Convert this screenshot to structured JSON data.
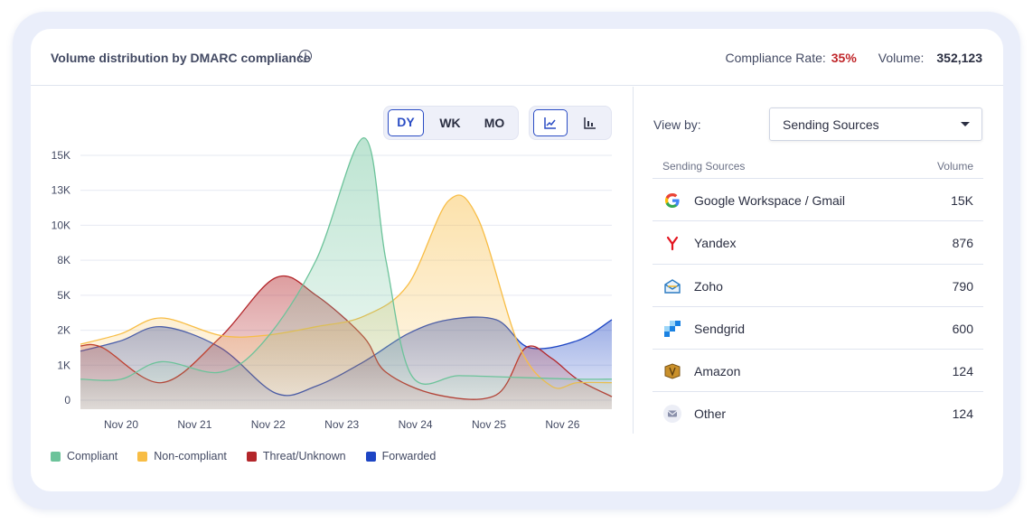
{
  "header": {
    "title": "Volume distribution by DMARC compliance",
    "info_icon": "info-icon",
    "compliance_label": "Compliance Rate:",
    "compliance_value": "35%",
    "volume_label": "Volume:",
    "volume_value": "352,123"
  },
  "toolbar": {
    "period": [
      "DY",
      "WK",
      "MO"
    ],
    "period_selected": "DY",
    "chart_types": [
      "line-chart-icon",
      "bar-chart-icon"
    ],
    "chart_type_selected": "line-chart-icon"
  },
  "side": {
    "view_by_label": "View by:",
    "view_by_value": "Sending Sources",
    "col_source": "Sending Sources",
    "col_volume": "Volume",
    "rows": [
      {
        "name": "Google Workspace / Gmail",
        "volume": "15K",
        "icon": "google-icon"
      },
      {
        "name": "Yandex",
        "volume": "876",
        "icon": "yandex-icon"
      },
      {
        "name": "Zoho",
        "volume": "790",
        "icon": "zoho-icon"
      },
      {
        "name": "Sendgrid",
        "volume": "600",
        "icon": "sendgrid-icon"
      },
      {
        "name": "Amazon",
        "volume": "124",
        "icon": "amazon-icon"
      },
      {
        "name": "Other",
        "volume": "124",
        "icon": "envelope-icon"
      }
    ]
  },
  "colors": {
    "compliant": "#6cc39a",
    "non_compliant": "#f8bd45",
    "threat": "#b3262a",
    "forwarded": "#1d45c4",
    "accent": "#2a4cc4",
    "rate": "#c0262a"
  },
  "chart_data": {
    "type": "area",
    "x": [
      "Nov 20",
      "Nov 21",
      "Nov 22",
      "Nov 23",
      "Nov 24",
      "Nov 25",
      "Nov 26"
    ],
    "y_ticks": [
      "0",
      "1K",
      "2K",
      "5K",
      "8K",
      "10K",
      "13K",
      "15K"
    ],
    "series": [
      {
        "name": "Compliant",
        "key": "compliant",
        "points": [
          [
            -0.55,
            0.6
          ],
          [
            0,
            0.6
          ],
          [
            0.55,
            1.1
          ],
          [
            1.35,
            0.8
          ],
          [
            1.95,
            1.7
          ],
          [
            2.65,
            4.0
          ],
          [
            3.3,
            7.5
          ],
          [
            3.6,
            4.0
          ],
          [
            3.95,
            0.7
          ],
          [
            4.6,
            0.7
          ],
          [
            5.4,
            0.65
          ],
          [
            6.2,
            0.6
          ],
          [
            6.7,
            0.6
          ]
        ]
      },
      {
        "name": "Non-compliant",
        "key": "non_compliant",
        "points": [
          [
            -0.55,
            1.6
          ],
          [
            0,
            1.9
          ],
          [
            0.55,
            2.35
          ],
          [
            1.35,
            1.85
          ],
          [
            1.95,
            1.85
          ],
          [
            2.65,
            2.1
          ],
          [
            3.3,
            2.4
          ],
          [
            3.9,
            3.3
          ],
          [
            4.45,
            5.7
          ],
          [
            4.85,
            5.2
          ],
          [
            5.4,
            1.6
          ],
          [
            5.85,
            0.4
          ],
          [
            6.2,
            0.5
          ],
          [
            6.7,
            0.5
          ]
        ]
      },
      {
        "name": "Threat/Unknown",
        "key": "threat",
        "points": [
          [
            -0.55,
            1.55
          ],
          [
            -0.25,
            1.5
          ],
          [
            0.55,
            0.5
          ],
          [
            1.35,
            1.8
          ],
          [
            2.1,
            3.5
          ],
          [
            2.65,
            3.0
          ],
          [
            3.3,
            1.8
          ],
          [
            3.6,
            0.8
          ],
          [
            4.3,
            0.15
          ],
          [
            5.1,
            0.15
          ],
          [
            5.5,
            1.5
          ],
          [
            5.85,
            1.2
          ],
          [
            6.2,
            0.6
          ],
          [
            6.7,
            0.1
          ]
        ]
      },
      {
        "name": "Forwarded",
        "key": "forwarded",
        "points": [
          [
            -0.55,
            1.4
          ],
          [
            0,
            1.7
          ],
          [
            0.55,
            2.1
          ],
          [
            1.35,
            1.5
          ],
          [
            2.1,
            0.2
          ],
          [
            2.65,
            0.4
          ],
          [
            3.3,
            1.1
          ],
          [
            3.9,
            1.9
          ],
          [
            4.45,
            2.3
          ],
          [
            5.1,
            2.3
          ],
          [
            5.55,
            1.5
          ],
          [
            6.2,
            1.7
          ],
          [
            6.7,
            2.3
          ]
        ]
      }
    ],
    "legend_position": "bottom-left",
    "grid": true
  }
}
